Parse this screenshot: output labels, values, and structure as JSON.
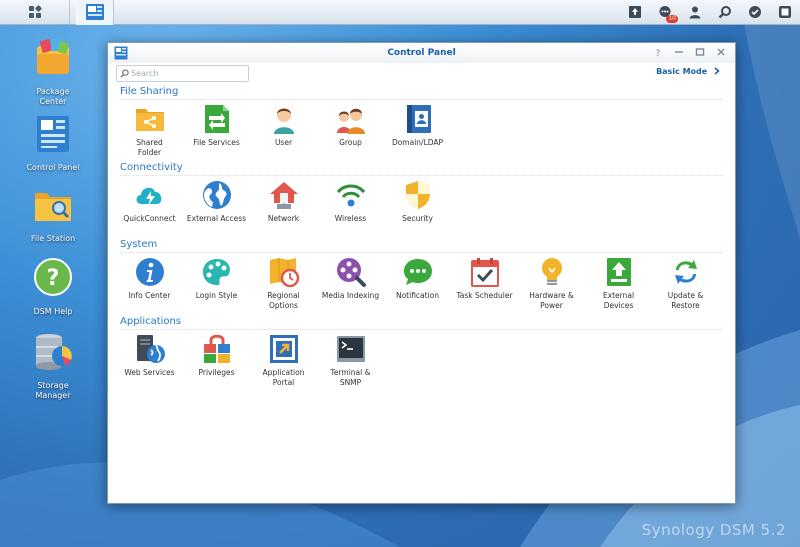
{
  "taskbar": {
    "main_menu_icon": "grid-icon",
    "active_app_icon": "control-panel-icon",
    "notification_count": "10",
    "right_icons": [
      "upload-icon",
      "chat-icon",
      "user-icon",
      "search-icon",
      "widgets-icon",
      "dsm-icon"
    ]
  },
  "desktop": {
    "icons": [
      {
        "label": "Package\nCenter",
        "icon": "package-center-icon"
      },
      {
        "label": "Control Panel",
        "icon": "control-panel-icon"
      },
      {
        "label": "File Station",
        "icon": "file-station-icon"
      },
      {
        "label": "DSM Help",
        "icon": "help-icon"
      },
      {
        "label": "Storage\nManager",
        "icon": "storage-manager-icon"
      }
    ],
    "watermark": "Synology DSM 5.2"
  },
  "window": {
    "title": "Control Panel",
    "search_placeholder": "Search",
    "basic_mode_label": "Basic Mode",
    "controls": [
      "help",
      "minimize",
      "maximize",
      "close"
    ],
    "sections": [
      {
        "title": "File Sharing",
        "items": [
          {
            "label": "Shared\nFolder",
            "icon": "shared-folder-icon"
          },
          {
            "label": "File Services",
            "icon": "file-services-icon"
          },
          {
            "label": "User",
            "icon": "user-icon"
          },
          {
            "label": "Group",
            "icon": "group-icon"
          },
          {
            "label": "Domain/LDAP",
            "icon": "domain-ldap-icon"
          }
        ]
      },
      {
        "title": "Connectivity",
        "items": [
          {
            "label": "QuickConnect",
            "icon": "quickconnect-icon"
          },
          {
            "label": "External Access",
            "icon": "external-access-icon"
          },
          {
            "label": "Network",
            "icon": "network-icon"
          },
          {
            "label": "Wireless",
            "icon": "wireless-icon"
          },
          {
            "label": "Security",
            "icon": "security-icon"
          }
        ]
      },
      {
        "title": "System",
        "items": [
          {
            "label": "Info Center",
            "icon": "info-center-icon"
          },
          {
            "label": "Login Style",
            "icon": "login-style-icon"
          },
          {
            "label": "Regional\nOptions",
            "icon": "regional-options-icon"
          },
          {
            "label": "Media Indexing",
            "icon": "media-indexing-icon"
          },
          {
            "label": "Notification",
            "icon": "notification-icon"
          },
          {
            "label": "Task Scheduler",
            "icon": "task-scheduler-icon"
          },
          {
            "label": "Hardware &\nPower",
            "icon": "hardware-power-icon"
          },
          {
            "label": "External\nDevices",
            "icon": "external-devices-icon"
          },
          {
            "label": "Update &\nRestore",
            "icon": "update-restore-icon"
          }
        ]
      },
      {
        "title": "Applications",
        "items": [
          {
            "label": "Web Services",
            "icon": "web-services-icon"
          },
          {
            "label": "Privileges",
            "icon": "privileges-icon"
          },
          {
            "label": "Application\nPortal",
            "icon": "application-portal-icon"
          },
          {
            "label": "Terminal &\nSNMP",
            "icon": "terminal-snmp-icon"
          }
        ]
      }
    ]
  }
}
